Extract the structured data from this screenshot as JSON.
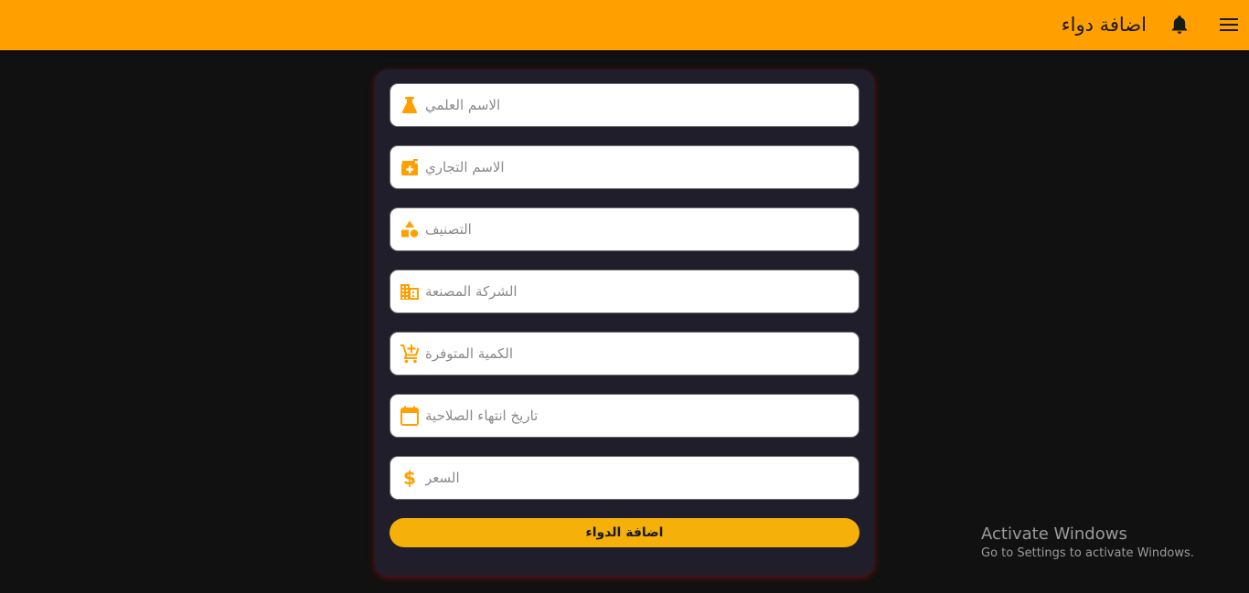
{
  "header": {
    "title": "اضافة دواء",
    "menu_icon": "menu-icon",
    "notification_icon": "bell-icon",
    "background": "#ff9f00"
  },
  "form": {
    "fields": [
      {
        "placeholder": "الاسم العلمي",
        "icon": "flask-icon"
      },
      {
        "placeholder": "الاسم التجاري",
        "icon": "medication-icon"
      },
      {
        "placeholder": "التصنيف",
        "icon": "category-icon"
      },
      {
        "placeholder": "الشركة المصنعة",
        "icon": "building-icon"
      },
      {
        "placeholder": "الكمية المتوفرة",
        "icon": "add-cart-icon"
      },
      {
        "placeholder": "تاريخ انتهاء الصلاحية",
        "icon": "calendar-icon"
      },
      {
        "placeholder": "السعر",
        "icon": "dollar-icon"
      }
    ],
    "submit_label": "اضافة الدواء",
    "accent_color": "#ff9f00",
    "button_color": "#f5b009"
  },
  "watermark": {
    "title": "Activate Windows",
    "subtitle": "Go to Settings to activate Windows."
  }
}
